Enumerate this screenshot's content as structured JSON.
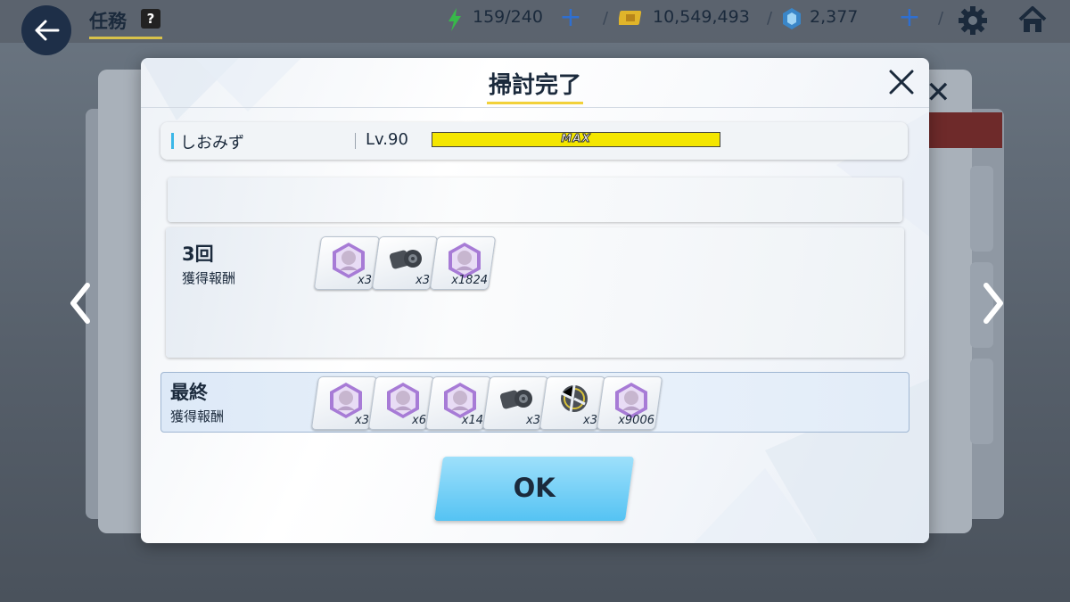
{
  "header": {
    "title": "任務",
    "help": "?",
    "ap": "159/240",
    "credits": "10,549,493",
    "gems": "2,377"
  },
  "modal": {
    "title": "掃討完了",
    "character": {
      "name": "しおみず",
      "level": "Lv.90",
      "exp_label": "MAX",
      "exp_fraction": 1.0
    },
    "sweep": {
      "count": "3回",
      "label": "獲得報酬",
      "items": [
        {
          "icon": "purple-hex-character-icon",
          "qty": "x3"
        },
        {
          "icon": "gear-part-icon",
          "qty": "x3"
        },
        {
          "icon": "purple-hex-character-icon",
          "qty": "x1824"
        }
      ]
    },
    "final": {
      "title": "最終",
      "label": "獲得報酬",
      "items": [
        {
          "icon": "purple-hex-character-icon",
          "qty": "x3"
        },
        {
          "icon": "purple-hex-character-icon",
          "qty": "x6"
        },
        {
          "icon": "purple-hex-character-icon",
          "qty": "x14"
        },
        {
          "icon": "gear-part-icon",
          "qty": "x3"
        },
        {
          "icon": "broken-disc-icon",
          "qty": "x3"
        },
        {
          "icon": "purple-hex-character-icon",
          "qty": "x9006"
        }
      ]
    },
    "ok_label": "OK"
  },
  "colors": {
    "accent_yellow": "#f2d13a",
    "exp_bar": "#f4e600",
    "ok_button": "#55c3f3",
    "hex_purple": "#a77bd6",
    "navy_text": "#1b2a3c"
  }
}
